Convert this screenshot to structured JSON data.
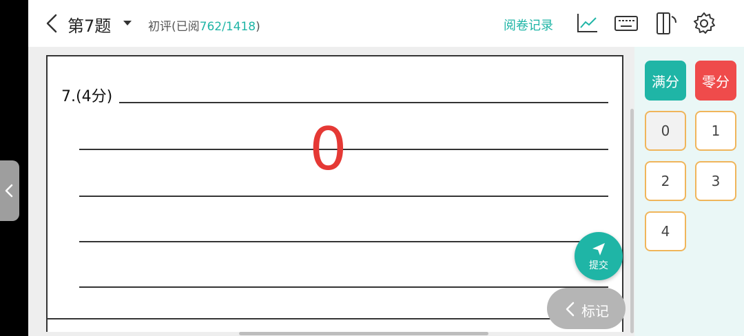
{
  "header": {
    "title": "第7题",
    "progress_prefix": "初评(已阅",
    "progress_count": "762/1418",
    "progress_suffix": ")",
    "record_label": "阅卷记录"
  },
  "answer_sheet": {
    "question_label": "7.(4分)",
    "marked_score": "0"
  },
  "score_panel": {
    "full_label": "满分",
    "zero_label": "零分",
    "scores": [
      "0",
      "1",
      "2",
      "3",
      "4"
    ],
    "selected": "0"
  },
  "actions": {
    "submit_label": "提交",
    "mark_label": "标记"
  },
  "colors": {
    "accent": "#1fb5a6",
    "danger": "#ef4b4b",
    "score_border": "#f0b55a"
  }
}
